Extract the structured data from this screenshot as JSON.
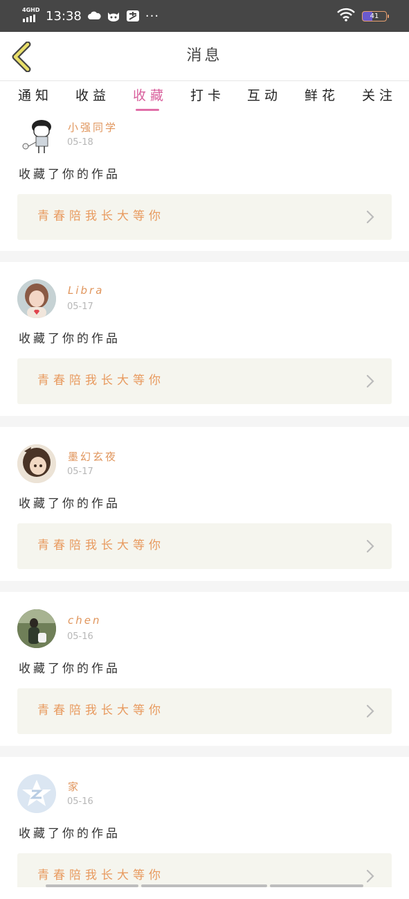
{
  "status_bar": {
    "network": "4GHD",
    "time": "13:38",
    "dots": "···",
    "battery": "41",
    "icons": [
      "signal-icon",
      "weather-cloud-icon",
      "cat-app-icon",
      "alipay-icon",
      "wifi-icon",
      "battery-icon"
    ]
  },
  "header": {
    "title": "消息",
    "back_icon": "chevron-left-icon"
  },
  "tabs": [
    {
      "label": "通知"
    },
    {
      "label": "收益"
    },
    {
      "label": "收藏"
    },
    {
      "label": "打卡"
    },
    {
      "label": "互动"
    },
    {
      "label": "鲜花"
    },
    {
      "label": "关注"
    }
  ],
  "active_tab": "收藏",
  "colors": {
    "accent_tab": "#d85f9c",
    "username": "#e0955c",
    "work_title": "#e89a5f",
    "work_bg": "#f5f5ee",
    "status_bar": "#464646"
  },
  "items": [
    {
      "user": "小强同学",
      "date": "05-18",
      "action": "收藏了你的作品",
      "work": "青春陪我长大等你"
    },
    {
      "user": "Libra",
      "date": "05-17",
      "action": "收藏了你的作品",
      "work": "青春陪我长大等你"
    },
    {
      "user": "墨幻玄夜",
      "date": "05-17",
      "action": "收藏了你的作品",
      "work": "青春陪我长大等你"
    },
    {
      "user": "chen",
      "date": "05-16",
      "action": "收藏了你的作品",
      "work": "青春陪我长大等你"
    },
    {
      "user": "家",
      "date": "05-16",
      "action": "收藏了你的作品",
      "work": "青春陪我长大等你"
    }
  ]
}
